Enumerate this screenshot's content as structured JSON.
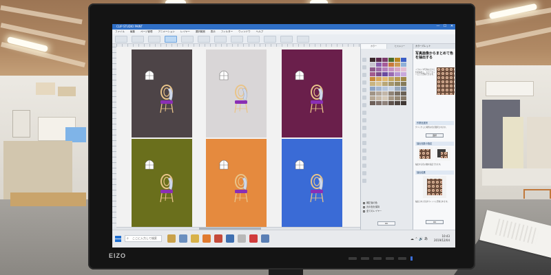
{
  "monitor": {
    "brand": "EIZO"
  },
  "app": {
    "title": "CLIP STUDIO PAINT",
    "window_controls": [
      "—",
      "☐",
      "✕"
    ],
    "menu": [
      "ファイル",
      "編集",
      "ページ管理",
      "アニメーション",
      "レイヤー",
      "選択範囲",
      "表示",
      "フィルター",
      "ウィンドウ",
      "ヘルプ"
    ],
    "toolbar": [
      "",
      "",
      "",
      "",
      "",
      "",
      "",
      "",
      "",
      "",
      "",
      ""
    ]
  },
  "canvas": {
    "panels": [
      {
        "bg": "#4d4447",
        "window": "#ffffff"
      },
      {
        "bg": "#d9d6d7",
        "window": "#ffffff"
      },
      {
        "bg": "#6a1f4b",
        "window": "#ffffff"
      },
      {
        "bg": "#6a6f1c",
        "window": "#ffffff"
      },
      {
        "bg": "#e58a3e",
        "window": "#ffffff"
      },
      {
        "bg": "#3a6bd6",
        "window": "#ffffff"
      }
    ],
    "chair": {
      "frame": "#e9c489",
      "seat": "#8a2fb5",
      "cushion": "#cfd8ea"
    }
  },
  "side_a": {
    "tabs": [
      "カラー",
      "ヒストリー"
    ],
    "swatches": [
      "#3b2a2d",
      "#5b2a4b",
      "#7a3b6a",
      "#4a6b2a",
      "#b8851e",
      "#3a5ec6",
      "#c9c6d0",
      "#8b5fae",
      "#a65c9a",
      "#c97a3a",
      "#cc9a55",
      "#8fb0d8",
      "#8e5a8b",
      "#9e6aa6",
      "#b480bc",
      "#c592c0",
      "#d7a6c4",
      "#e4bdd2",
      "#a25b8f",
      "#7e4d8b",
      "#6a4aa0",
      "#9a6ab2",
      "#b794d3",
      "#c8a8dd",
      "#c98a3a",
      "#d8a85a",
      "#e2b870",
      "#c4a760",
      "#b89850",
      "#a08848",
      "#c9b480",
      "#d8c394",
      "#b9a777",
      "#a5966c",
      "#948861",
      "#857a58",
      "#8ea4c4",
      "#a3b6d1",
      "#b6c6dc",
      "#c7d3e5",
      "#98a8bc",
      "#7f91a8",
      "#a09486",
      "#b3a698",
      "#c2b6a8",
      "#8f8376",
      "#7a7064",
      "#6a6155",
      "#b6a794",
      "#c7b9a6",
      "#d5c9b8",
      "#a69784",
      "#958774",
      "#857867",
      "#6d5f58",
      "#7e706a",
      "#8f827b",
      "#5e524c",
      "#4f4540",
      "#403834"
    ],
    "options": [
      "補正後の色",
      "元の色を保持",
      "全てのレイヤー"
    ],
    "apply_button": "OK"
  },
  "side_b": {
    "header": "カラーパレット",
    "title": "写真画像からまとめて色を抽出する",
    "desc": "イラストや写真などから色を抽出し、カラーセットとして登録できます。",
    "section1": "作業色選択",
    "section1_desc": "クリックした場所の色が選択されます。",
    "section1_button": "選択",
    "section2": "抽出色数の指定",
    "section2_desc": "抽出する色の数を指定できます。",
    "section3": "抽出結果",
    "section3_desc": "抽出された色がパレットに登録されます。",
    "ok_button": "OK"
  },
  "taskbar": {
    "search_placeholder": "ここに入力して検索",
    "search_glyph": "⌕",
    "tray_icons": "☁ ⌃ 🔊 あ",
    "time": "10:43",
    "date": "2019/12/04"
  }
}
